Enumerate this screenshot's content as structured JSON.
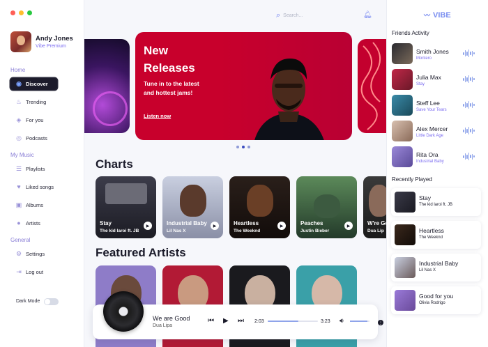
{
  "window": {
    "dot_colors": [
      "#ff5f57",
      "#ffbd2e",
      "#28c840"
    ]
  },
  "user": {
    "name": "Andy Jones",
    "plan": "Vibe Premium"
  },
  "sidebar": {
    "home_label": "Home",
    "home_items": [
      {
        "label": "Discover",
        "icon": "discover-icon",
        "active": true
      },
      {
        "label": "Trending",
        "icon": "flame-icon"
      },
      {
        "label": "For you",
        "icon": "compass-icon"
      },
      {
        "label": "Podcasts",
        "icon": "podcast-icon"
      }
    ],
    "music_label": "My Music",
    "music_items": [
      {
        "label": "Playlists",
        "icon": "playlist-icon"
      },
      {
        "label": "Liked songs",
        "icon": "heart-icon"
      },
      {
        "label": "Albums",
        "icon": "album-icon"
      },
      {
        "label": "Artists",
        "icon": "user-icon"
      }
    ],
    "general_label": "General",
    "general_items": [
      {
        "label": "Settings",
        "icon": "gear-icon"
      },
      {
        "label": "Log out",
        "icon": "logout-icon"
      }
    ],
    "dark_mode_label": "Dark Mode",
    "dark_mode_on": false
  },
  "topbar": {
    "search_placeholder": "Search..."
  },
  "hero": {
    "title": "New Releases",
    "tagline": "Tune in to the latest and hottest jams!",
    "cta": "Listen now",
    "accent": "#c8002c"
  },
  "charts": {
    "heading": "Charts",
    "items": [
      {
        "title": "Stay",
        "artist": "The kid laroi ft. JB"
      },
      {
        "title": "Industrial Baby",
        "artist": "Lil Nas X"
      },
      {
        "title": "Heartless",
        "artist": "The Weeknd"
      },
      {
        "title": "Peaches",
        "artist": "Justin Bieber"
      },
      {
        "title": "W're Go",
        "artist": "Dua Lip"
      }
    ]
  },
  "featured": {
    "heading": "Featured Artists"
  },
  "player": {
    "title": "We are Good",
    "artist": "Dua Lipa",
    "current_time": "2:03",
    "total_time": "3:23",
    "progress": 0.61,
    "volume": 0.9
  },
  "brand": {
    "name": "VIBE",
    "color": "#7a8ef0"
  },
  "friends": {
    "heading": "Friends Activity",
    "items": [
      {
        "name": "Smith Jones",
        "song": "Montero"
      },
      {
        "name": "Julia Max",
        "song": "Stay"
      },
      {
        "name": "Steff Lee",
        "song": "Save Your Tears"
      },
      {
        "name": "Alex Mercer",
        "song": "Little Dark Age"
      },
      {
        "name": "Rita Ora",
        "song": "Industrial Baby"
      }
    ]
  },
  "recent": {
    "heading": "Recently Played",
    "items": [
      {
        "title": "Stay",
        "artist": "The kid laroi ft. JB"
      },
      {
        "title": "Heartless",
        "artist": "The Weeknd"
      },
      {
        "title": "Industrial Baby",
        "artist": "Lil Nas X"
      },
      {
        "title": "Good for you",
        "artist": "Olivia Rodrigo"
      }
    ]
  }
}
